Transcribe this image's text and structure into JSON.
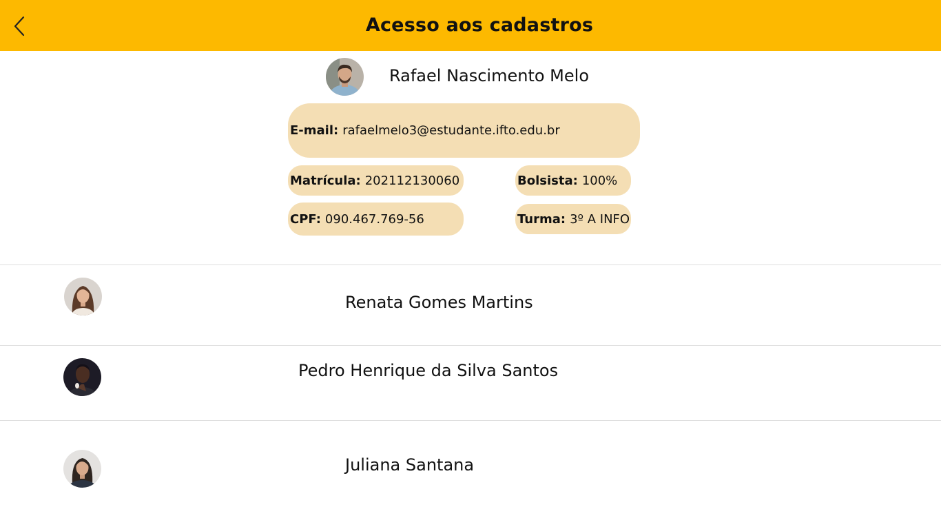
{
  "header": {
    "title": "Acesso aos cadastros",
    "background_color": "#FDB900",
    "back_icon": "chevron-left-icon"
  },
  "selected_student": {
    "name": "Rafael Nascimento Melo",
    "email": {
      "label": "E-mail:",
      "value": "rafaelmelo3@estudante.ifto.edu.br"
    },
    "matricula": {
      "label": "Matrícula:",
      "value": "202112130060"
    },
    "cpf": {
      "label": "CPF:",
      "value": "090.467.769-56"
    },
    "bolsista": {
      "label": "Bolsista:",
      "value": "100%"
    },
    "turma": {
      "label": "Turma:",
      "value": "3º A INFO"
    },
    "pill_color": "#F4DEB4"
  },
  "students": [
    {
      "name": "Renata Gomes Martins"
    },
    {
      "name": "Pedro Henrique da Silva Santos"
    },
    {
      "name": "Juliana Santana"
    }
  ]
}
